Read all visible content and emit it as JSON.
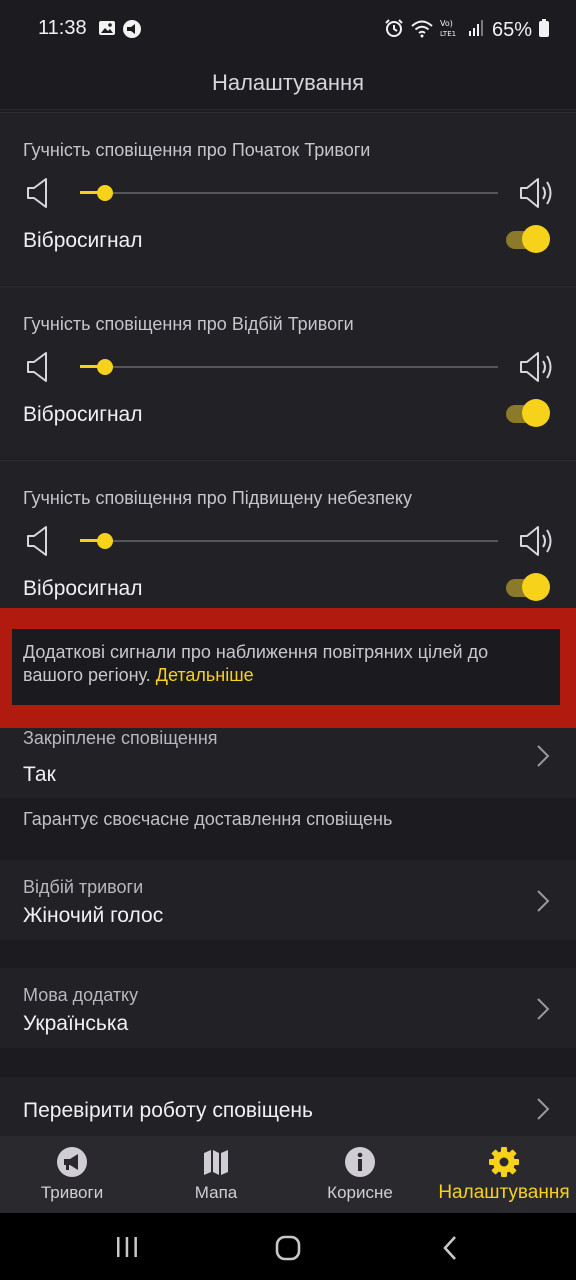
{
  "status_bar": {
    "time": "11:38",
    "battery": "65%"
  },
  "header": {
    "title": "Налаштування"
  },
  "volume_sections": [
    {
      "title": "Гучність сповіщення про Початок Тривоги",
      "volume_level": 0.06,
      "vibration_label": "Вібросигнал",
      "vibration_on": true
    },
    {
      "title": "Гучність сповіщення про Відбій Тривоги",
      "volume_level": 0.06,
      "vibration_label": "Вібросигнал",
      "vibration_on": true
    },
    {
      "title": "Гучність сповіщення про Підвищену небезпеку",
      "volume_level": 0.06,
      "vibration_label": "Вібросигнал",
      "vibration_on": true
    }
  ],
  "banner": {
    "text": "Додаткові сигнали про наближення повітряних цілей до вашого регіону.",
    "link": "Детальніше"
  },
  "pinned": {
    "label": "Закріплене сповіщення",
    "value": "Так",
    "hint": "Гарантує своєчасне доставлення сповіщень"
  },
  "all_clear": {
    "label": "Відбій тривоги",
    "value": "Жіночий голос"
  },
  "language": {
    "label": "Мова додатку",
    "value": "Українська"
  },
  "test": {
    "label": "Перевірити роботу сповіщень"
  },
  "bottom_nav": [
    {
      "label": "Тривоги",
      "icon": "megaphone-icon"
    },
    {
      "label": "Мапа",
      "icon": "map-icon"
    },
    {
      "label": "Корисне",
      "icon": "info-icon"
    },
    {
      "label": "Налаштування",
      "icon": "gear-icon",
      "active": true
    }
  ],
  "colors": {
    "accent": "#f7d21a",
    "highlight": "#b11a0e",
    "background": "#1c1b1f"
  }
}
